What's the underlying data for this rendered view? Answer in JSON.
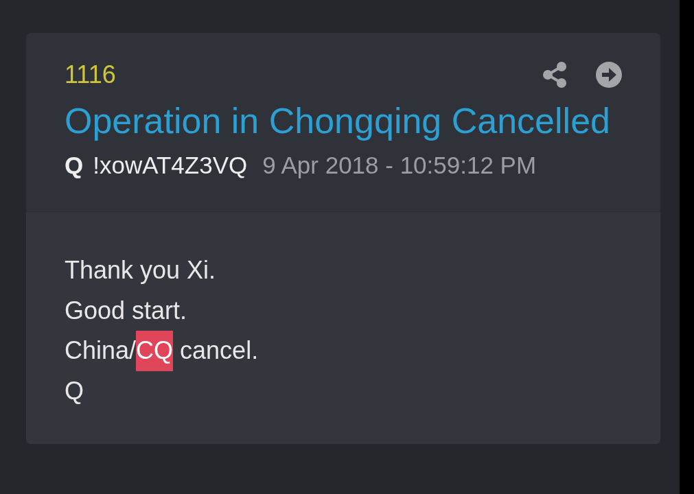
{
  "post": {
    "number": "1116",
    "title": "Operation in Chongqing Cancelled",
    "author": {
      "name": "Q",
      "tripcode": "!xowAT4Z3VQ"
    },
    "timestamp": "9 Apr 2018 - 10:59:12 PM",
    "lines": [
      [
        {
          "text": "Thank you Xi.",
          "highlighted": false
        }
      ],
      [
        {
          "text": "Good start.",
          "highlighted": false
        }
      ],
      [
        {
          "text": "China/",
          "highlighted": false
        },
        {
          "text": "CQ",
          "highlighted": true
        },
        {
          "text": " cancel.",
          "highlighted": false
        }
      ],
      [
        {
          "text": "Q",
          "highlighted": false
        }
      ]
    ]
  }
}
